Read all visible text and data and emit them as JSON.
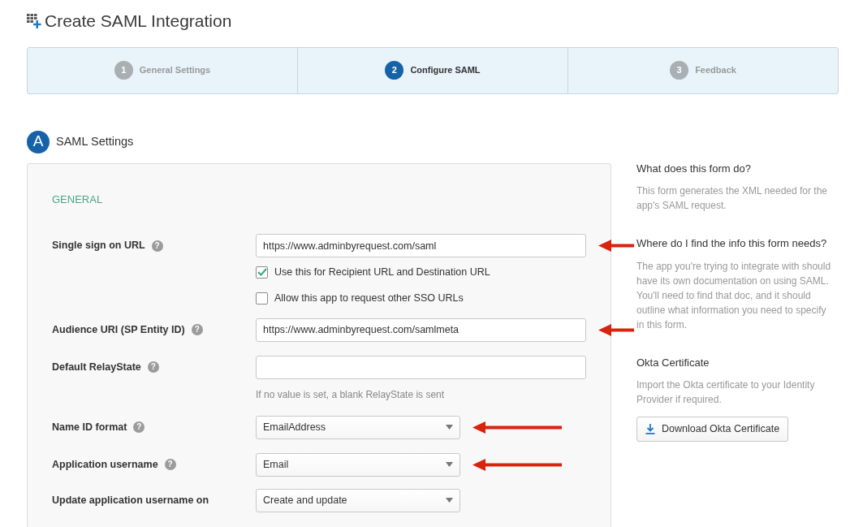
{
  "page_title": "Create SAML Integration",
  "steps": [
    {
      "number": "1",
      "label": "General Settings",
      "selected": false
    },
    {
      "number": "2",
      "label": "Configure SAML",
      "selected": true
    },
    {
      "number": "3",
      "label": "Feedback",
      "selected": false
    }
  ],
  "section": {
    "letter": "A",
    "title": "SAML Settings"
  },
  "form": {
    "group_title": "GENERAL",
    "rows": [
      {
        "kind": "text",
        "label": "Single sign on URL",
        "help": "?",
        "value": "https://www.adminbyrequest.com/saml",
        "arrow": true,
        "checkboxes": [
          {
            "label": "Use this for Recipient URL and Destination URL",
            "checked": true
          },
          {
            "label": "Allow this app to request other SSO URLs",
            "checked": false
          }
        ]
      },
      {
        "kind": "text",
        "label": "Audience URI (SP Entity ID)",
        "help": "?",
        "value": "https://www.adminbyrequest.com/samlmeta",
        "arrow": true
      },
      {
        "kind": "text",
        "label": "Default RelayState",
        "help": "?",
        "value": "",
        "arrow": false,
        "hint": "If no value is set, a blank RelayState is sent"
      },
      {
        "kind": "select",
        "label": "Name ID format",
        "help": "?",
        "value": "EmailAddress",
        "arrow": true
      },
      {
        "kind": "select",
        "label": "Application username",
        "help": "?",
        "value": "Email",
        "arrow": true
      },
      {
        "kind": "select",
        "label": "Update application username on",
        "value": "Create and update",
        "arrow": false
      }
    ]
  },
  "sidebar": [
    {
      "heading": "What does this form do?",
      "text": "This form generates the XML needed for the app's SAML request."
    },
    {
      "heading": "Where do I find the info this form needs?",
      "text": "The app you're trying to integrate with should have its own documentation on using SAML. You'll need to find that doc, and it should outline what information you need to specify in this form."
    },
    {
      "heading": "Okta Certificate",
      "text": "Import the Okta certificate to your Identity Provider if required.",
      "button": "Download Okta Certificate"
    }
  ]
}
